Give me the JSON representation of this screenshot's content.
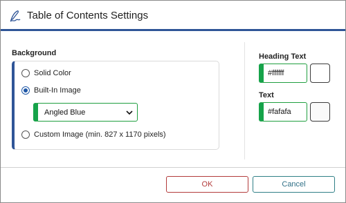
{
  "dialog": {
    "title": "Table of Contents Settings",
    "title_icon": "signature-pen-icon"
  },
  "background": {
    "label": "Background",
    "options": [
      {
        "label": "Solid Color",
        "checked": false
      },
      {
        "label": "Built-In Image",
        "checked": true
      },
      {
        "label": "Custom Image (min. 827 x 1170 pixels)",
        "checked": false
      }
    ],
    "image_select": {
      "value": "Angled Blue"
    }
  },
  "heading_text": {
    "label": "Heading Text",
    "color_value": "#ffffff",
    "swatch_color": "#ffffff"
  },
  "text": {
    "label": "Text",
    "color_value": "#fafafa",
    "swatch_color": "#fafafa"
  },
  "buttons": {
    "ok": "OK",
    "cancel": "Cancel"
  },
  "colors": {
    "accent": "#2f5597",
    "field_accent": "#16a34a",
    "ok_border": "#b23a3a",
    "cancel_border": "#2f7f86"
  }
}
